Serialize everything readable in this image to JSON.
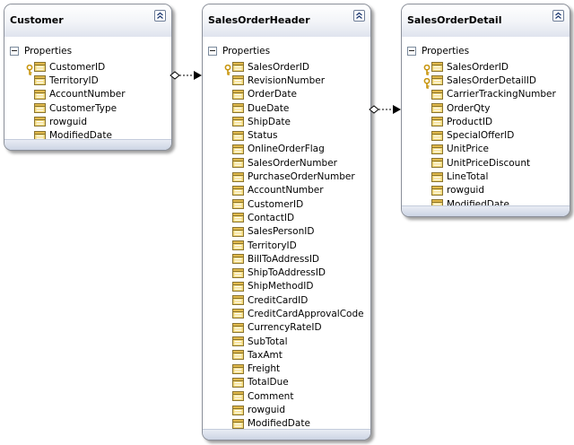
{
  "entities": {
    "customer": {
      "title": "Customer",
      "section": "Properties",
      "properties": [
        {
          "name": "CustomerID",
          "key": true
        },
        {
          "name": "TerritoryID",
          "key": false
        },
        {
          "name": "AccountNumber",
          "key": false
        },
        {
          "name": "CustomerType",
          "key": false
        },
        {
          "name": "rowguid",
          "key": false
        },
        {
          "name": "ModifiedDate",
          "key": false
        }
      ]
    },
    "salesorderheader": {
      "title": "SalesOrderHeader",
      "section": "Properties",
      "properties": [
        {
          "name": "SalesOrderID",
          "key": true
        },
        {
          "name": "RevisionNumber",
          "key": false
        },
        {
          "name": "OrderDate",
          "key": false
        },
        {
          "name": "DueDate",
          "key": false
        },
        {
          "name": "ShipDate",
          "key": false
        },
        {
          "name": "Status",
          "key": false
        },
        {
          "name": "OnlineOrderFlag",
          "key": false
        },
        {
          "name": "SalesOrderNumber",
          "key": false
        },
        {
          "name": "PurchaseOrderNumber",
          "key": false
        },
        {
          "name": "AccountNumber",
          "key": false
        },
        {
          "name": "CustomerID",
          "key": false
        },
        {
          "name": "ContactID",
          "key": false
        },
        {
          "name": "SalesPersonID",
          "key": false
        },
        {
          "name": "TerritoryID",
          "key": false
        },
        {
          "name": "BillToAddressID",
          "key": false
        },
        {
          "name": "ShipToAddressID",
          "key": false
        },
        {
          "name": "ShipMethodID",
          "key": false
        },
        {
          "name": "CreditCardID",
          "key": false
        },
        {
          "name": "CreditCardApprovalCode",
          "key": false
        },
        {
          "name": "CurrencyRateID",
          "key": false
        },
        {
          "name": "SubTotal",
          "key": false
        },
        {
          "name": "TaxAmt",
          "key": false
        },
        {
          "name": "Freight",
          "key": false
        },
        {
          "name": "TotalDue",
          "key": false
        },
        {
          "name": "Comment",
          "key": false
        },
        {
          "name": "rowguid",
          "key": false
        },
        {
          "name": "ModifiedDate",
          "key": false
        }
      ]
    },
    "salesorderdetail": {
      "title": "SalesOrderDetail",
      "section": "Properties",
      "properties": [
        {
          "name": "SalesOrderID",
          "key": true
        },
        {
          "name": "SalesOrderDetailID",
          "key": true
        },
        {
          "name": "CarrierTrackingNumber",
          "key": false
        },
        {
          "name": "OrderQty",
          "key": false
        },
        {
          "name": "ProductID",
          "key": false
        },
        {
          "name": "SpecialOfferID",
          "key": false
        },
        {
          "name": "UnitPrice",
          "key": false
        },
        {
          "name": "UnitPriceDiscount",
          "key": false
        },
        {
          "name": "LineTotal",
          "key": false
        },
        {
          "name": "rowguid",
          "key": false
        },
        {
          "name": "ModifiedDate",
          "key": false
        }
      ]
    }
  },
  "associations": [
    {
      "from": "Customer",
      "to": "SalesOrderHeader"
    },
    {
      "from": "SalesOrderHeader",
      "to": "SalesOrderDetail"
    }
  ],
  "icons": {
    "collapse": "double-chevron-up-icon",
    "expander": "minus-box-icon",
    "property": "property-icon",
    "key": "key-icon"
  },
  "colors": {
    "border": "#8a8f99",
    "header_gradient_end": "#dfe4ee",
    "key_color": "#d4a017",
    "icon_fill": "#f0d070",
    "icon_border": "#7a6a30"
  }
}
